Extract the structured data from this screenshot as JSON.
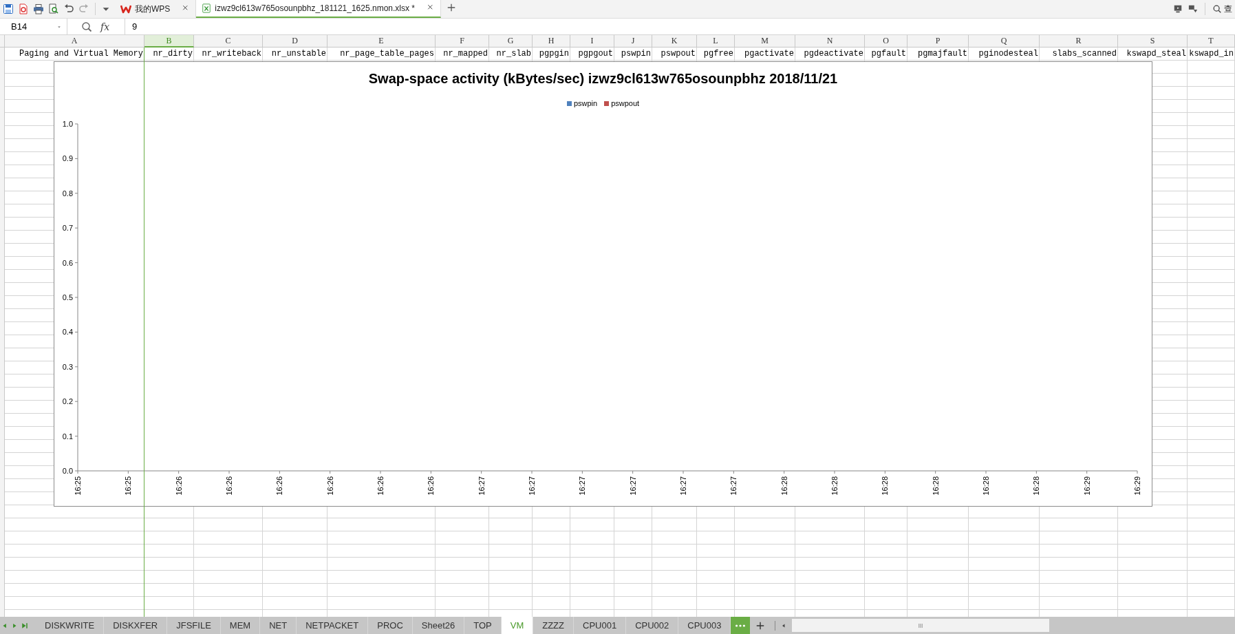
{
  "doc_tabs": [
    {
      "kind": "home",
      "label": "我的WPS",
      "selected": false
    },
    {
      "kind": "file",
      "label": "izwz9cl613w765osounpbhz_181121_1625.nmon.xlsx *",
      "selected": true
    }
  ],
  "search_button": {
    "label": "查"
  },
  "formula_bar": {
    "cell_ref": "B14",
    "function_label": "fx",
    "value": "9"
  },
  "sheet": {
    "columns": [
      {
        "label": "A",
        "selected": false
      },
      {
        "label": "B",
        "selected": true
      },
      {
        "label": "C",
        "selected": false
      },
      {
        "label": "D",
        "selected": false
      },
      {
        "label": "E",
        "selected": false
      },
      {
        "label": "F",
        "selected": false
      },
      {
        "label": "G",
        "selected": false
      },
      {
        "label": "H",
        "selected": false
      },
      {
        "label": "I",
        "selected": false
      },
      {
        "label": "J",
        "selected": false
      },
      {
        "label": "K",
        "selected": false
      },
      {
        "label": "L",
        "selected": false
      },
      {
        "label": "M",
        "selected": false
      },
      {
        "label": "N",
        "selected": false
      },
      {
        "label": "O",
        "selected": false
      },
      {
        "label": "P",
        "selected": false
      },
      {
        "label": "Q",
        "selected": false
      },
      {
        "label": "R",
        "selected": false
      },
      {
        "label": "S",
        "selected": false
      },
      {
        "label": "T",
        "selected": false
      }
    ],
    "row_1": [
      "Paging and Virtual Memory",
      "nr_dirty",
      "nr_writeback",
      "nr_unstable",
      "nr_page_table_pages",
      "nr_mapped",
      "nr_slab",
      "pgpgin",
      "pgpgout",
      "pswpin",
      "pswpout",
      "pgfree",
      "pgactivate",
      "pgdeactivate",
      "pgfault",
      "pgmajfault",
      "pginodesteal",
      "slabs_scanned",
      "kswapd_steal",
      "kswapd_in"
    ],
    "chart_data": {
      "type": "line",
      "title": "Swap-space activity (kBytes/sec) izwz9cl613w765osounpbhz 2018/11/21",
      "categories": [
        "16:25",
        "16:25",
        "16:26",
        "16:26",
        "16:26",
        "16:26",
        "16:26",
        "16:26",
        "16:27",
        "16:27",
        "16:27",
        "16:27",
        "16:27",
        "16:27",
        "16:28",
        "16:28",
        "16:28",
        "16:28",
        "16:28",
        "16:28",
        "16:29",
        "16:29"
      ],
      "series": [
        {
          "name": "pswpin",
          "color": "#4f81bd",
          "values": [
            null,
            null,
            null,
            null,
            null,
            null,
            null,
            null,
            null,
            null,
            null,
            null,
            null,
            null,
            null,
            null,
            null,
            null,
            null,
            null,
            null,
            null
          ]
        },
        {
          "name": "pswpout",
          "color": "#c0504d",
          "values": [
            null,
            null,
            null,
            null,
            null,
            null,
            null,
            null,
            null,
            null,
            null,
            null,
            null,
            null,
            null,
            null,
            null,
            null,
            null,
            null,
            null,
            null
          ]
        }
      ],
      "ylim": [
        0,
        1
      ],
      "yticks": [
        {
          "value": 0,
          "label": "0.0"
        },
        {
          "value": 0.1,
          "label": "0.1"
        },
        {
          "value": 0.2,
          "label": "0.2"
        },
        {
          "value": 0.3,
          "label": "0.3"
        },
        {
          "value": 0.4,
          "label": "0.4"
        },
        {
          "value": 0.5,
          "label": "0.5"
        },
        {
          "value": 0.6,
          "label": "0.6"
        },
        {
          "value": 0.7,
          "label": "0.7"
        },
        {
          "value": 0.8,
          "label": "0.8"
        },
        {
          "value": 0.9,
          "label": "0.9"
        },
        {
          "value": 1,
          "label": "1.0"
        }
      ]
    }
  },
  "sheet_tabs": [
    {
      "label": "DISKWRITE",
      "selected": false
    },
    {
      "label": "DISKXFER",
      "selected": false
    },
    {
      "label": "JFSFILE",
      "selected": false
    },
    {
      "label": "MEM",
      "selected": false
    },
    {
      "label": "NET",
      "selected": false
    },
    {
      "label": "NETPACKET",
      "selected": false
    },
    {
      "label": "PROC",
      "selected": false
    },
    {
      "label": "Sheet26",
      "selected": false
    },
    {
      "label": "TOP",
      "selected": false
    },
    {
      "label": "VM",
      "selected": true
    },
    {
      "label": "ZZZZ",
      "selected": false
    },
    {
      "label": "CPU001",
      "selected": false
    },
    {
      "label": "CPU002",
      "selected": false
    },
    {
      "label": "CPU003",
      "selected": false
    }
  ]
}
